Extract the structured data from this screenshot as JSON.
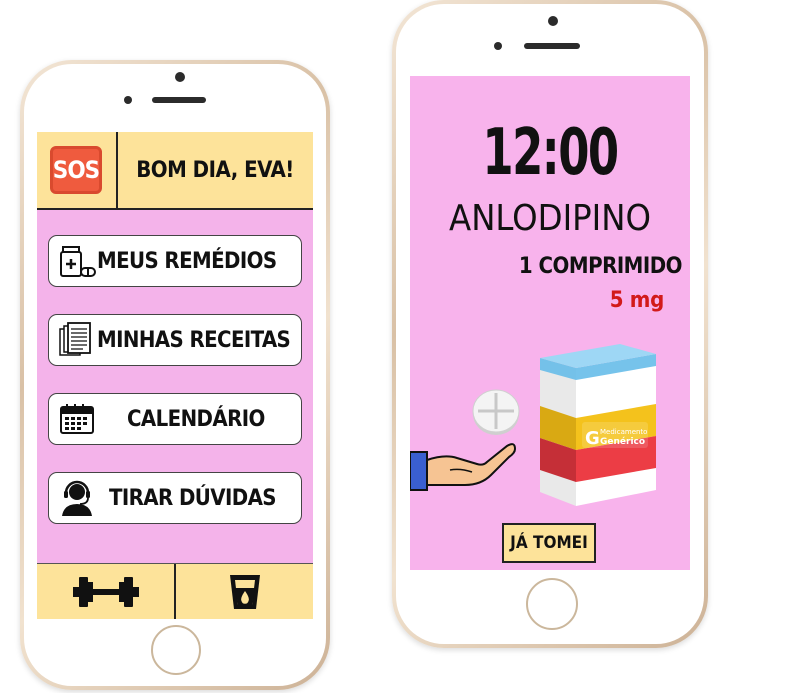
{
  "left_screen": {
    "sos_label": "SOS",
    "greeting": "BOM DIA, EVA!",
    "menu": [
      {
        "label": "MEUS REMÉDIOS",
        "icon": "medicine-icon"
      },
      {
        "label": "MINHAS RECEITAS",
        "icon": "prescriptions-icon"
      },
      {
        "label": "CALENDÁRIO",
        "icon": "calendar-icon"
      },
      {
        "label": "TIRAR DÚVIDAS",
        "icon": "support-agent-icon"
      }
    ],
    "bottom_nav": [
      {
        "icon": "dumbbell-icon"
      },
      {
        "icon": "water-glass-icon"
      }
    ]
  },
  "right_screen": {
    "time": "12:00",
    "medication_name": "ANLODIPINO",
    "dose": "1 COMPRIMIDO",
    "strength": "5 mg",
    "box_label_line1": "Medicamento",
    "box_label_line2": "Genérico",
    "box_letter": "G",
    "taken_button": "JÁ TOMEI"
  },
  "colors": {
    "screen_pink": "#f4b3ea",
    "bar_yellow": "#fde39a",
    "sos_red": "#ef5b3e",
    "strength_red": "#d21a1a"
  }
}
